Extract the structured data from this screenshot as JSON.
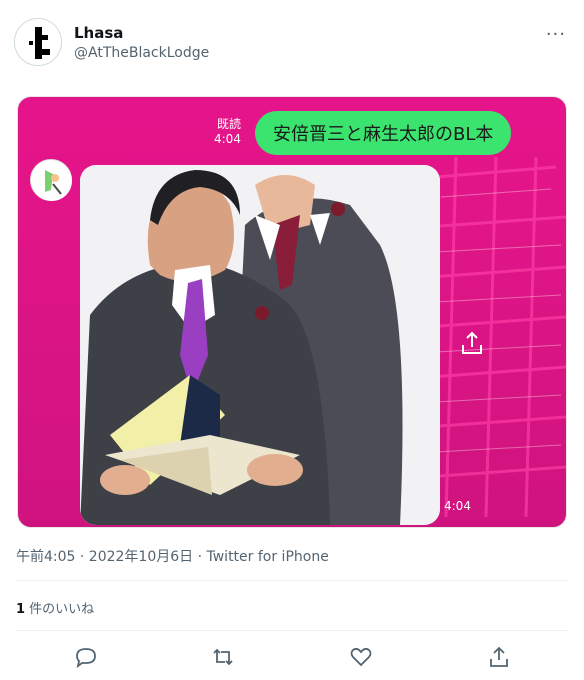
{
  "tweet": {
    "author_name": "Lhasa",
    "author_handle": "@AtTheBlackLodge",
    "more_label": "···",
    "timestamp": "午前4:05 · 2022年10月6日 · Twitter for iPhone",
    "likes_count": "1",
    "likes_label": " 件のいいね"
  },
  "media": {
    "chat_message": "安倍晋三と麻生太郎のBL本",
    "read_status": "既読",
    "read_time": "4:04",
    "image_time": "4:04"
  },
  "icons": [
    "more-icon",
    "share-icon",
    "reply-icon",
    "retweet-icon",
    "like-icon",
    "share-action-icon"
  ],
  "colors": {
    "line_green": "#3be36f",
    "magenta": "#e01587",
    "muted_text": "#536471"
  }
}
